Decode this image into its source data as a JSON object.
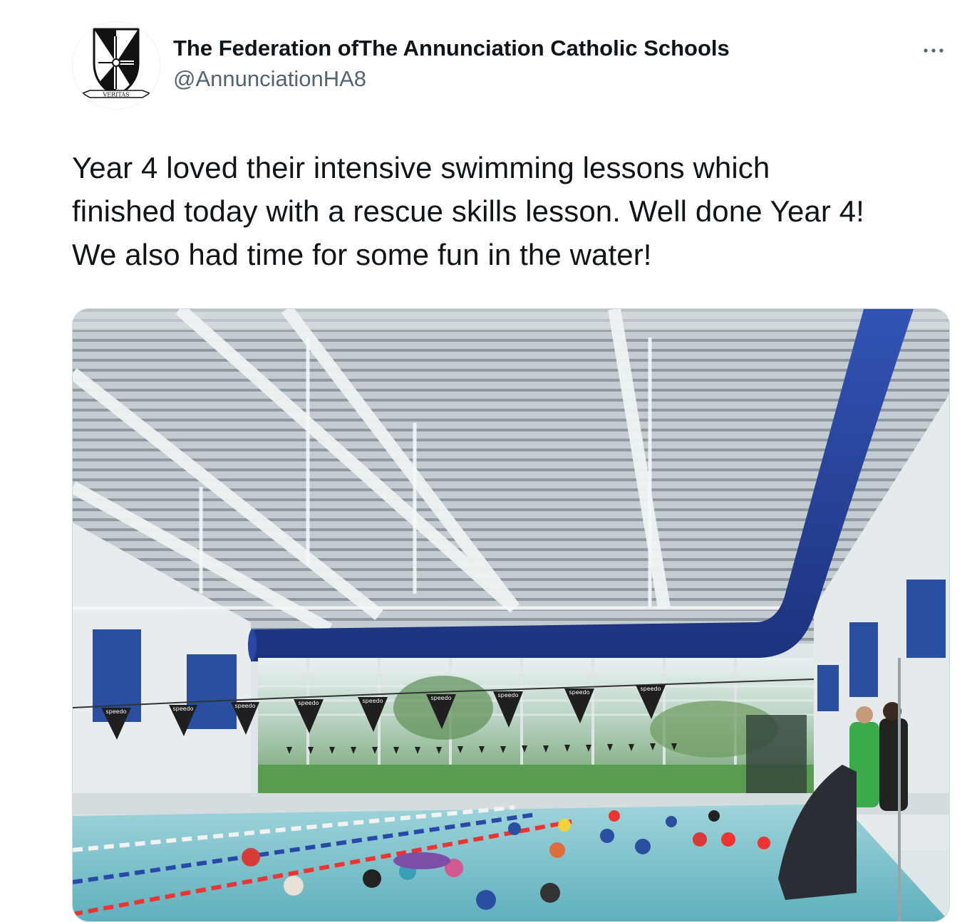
{
  "author": {
    "display_name": "The Federation ofThe Annunciation Catholic Schools",
    "handle": "@AnnunciationHA8",
    "avatar_motto": "VERITAS",
    "avatar_icon": "dominican-shield-crest"
  },
  "menu": {
    "icon": "more-horizontal-icon"
  },
  "tweet": {
    "lines": [
      "Year 4 loved their intensive swimming lessons which",
      "finished today with a rescue skills lesson. Well done Year 4!",
      "We also had time for some fun in the water!"
    ]
  },
  "media": {
    "bunting_text": "speedo"
  },
  "colors": {
    "text": "#0f1419",
    "secondary": "#536471",
    "duct_blue": "#24409a",
    "pool_water": "#7fc4cf"
  }
}
